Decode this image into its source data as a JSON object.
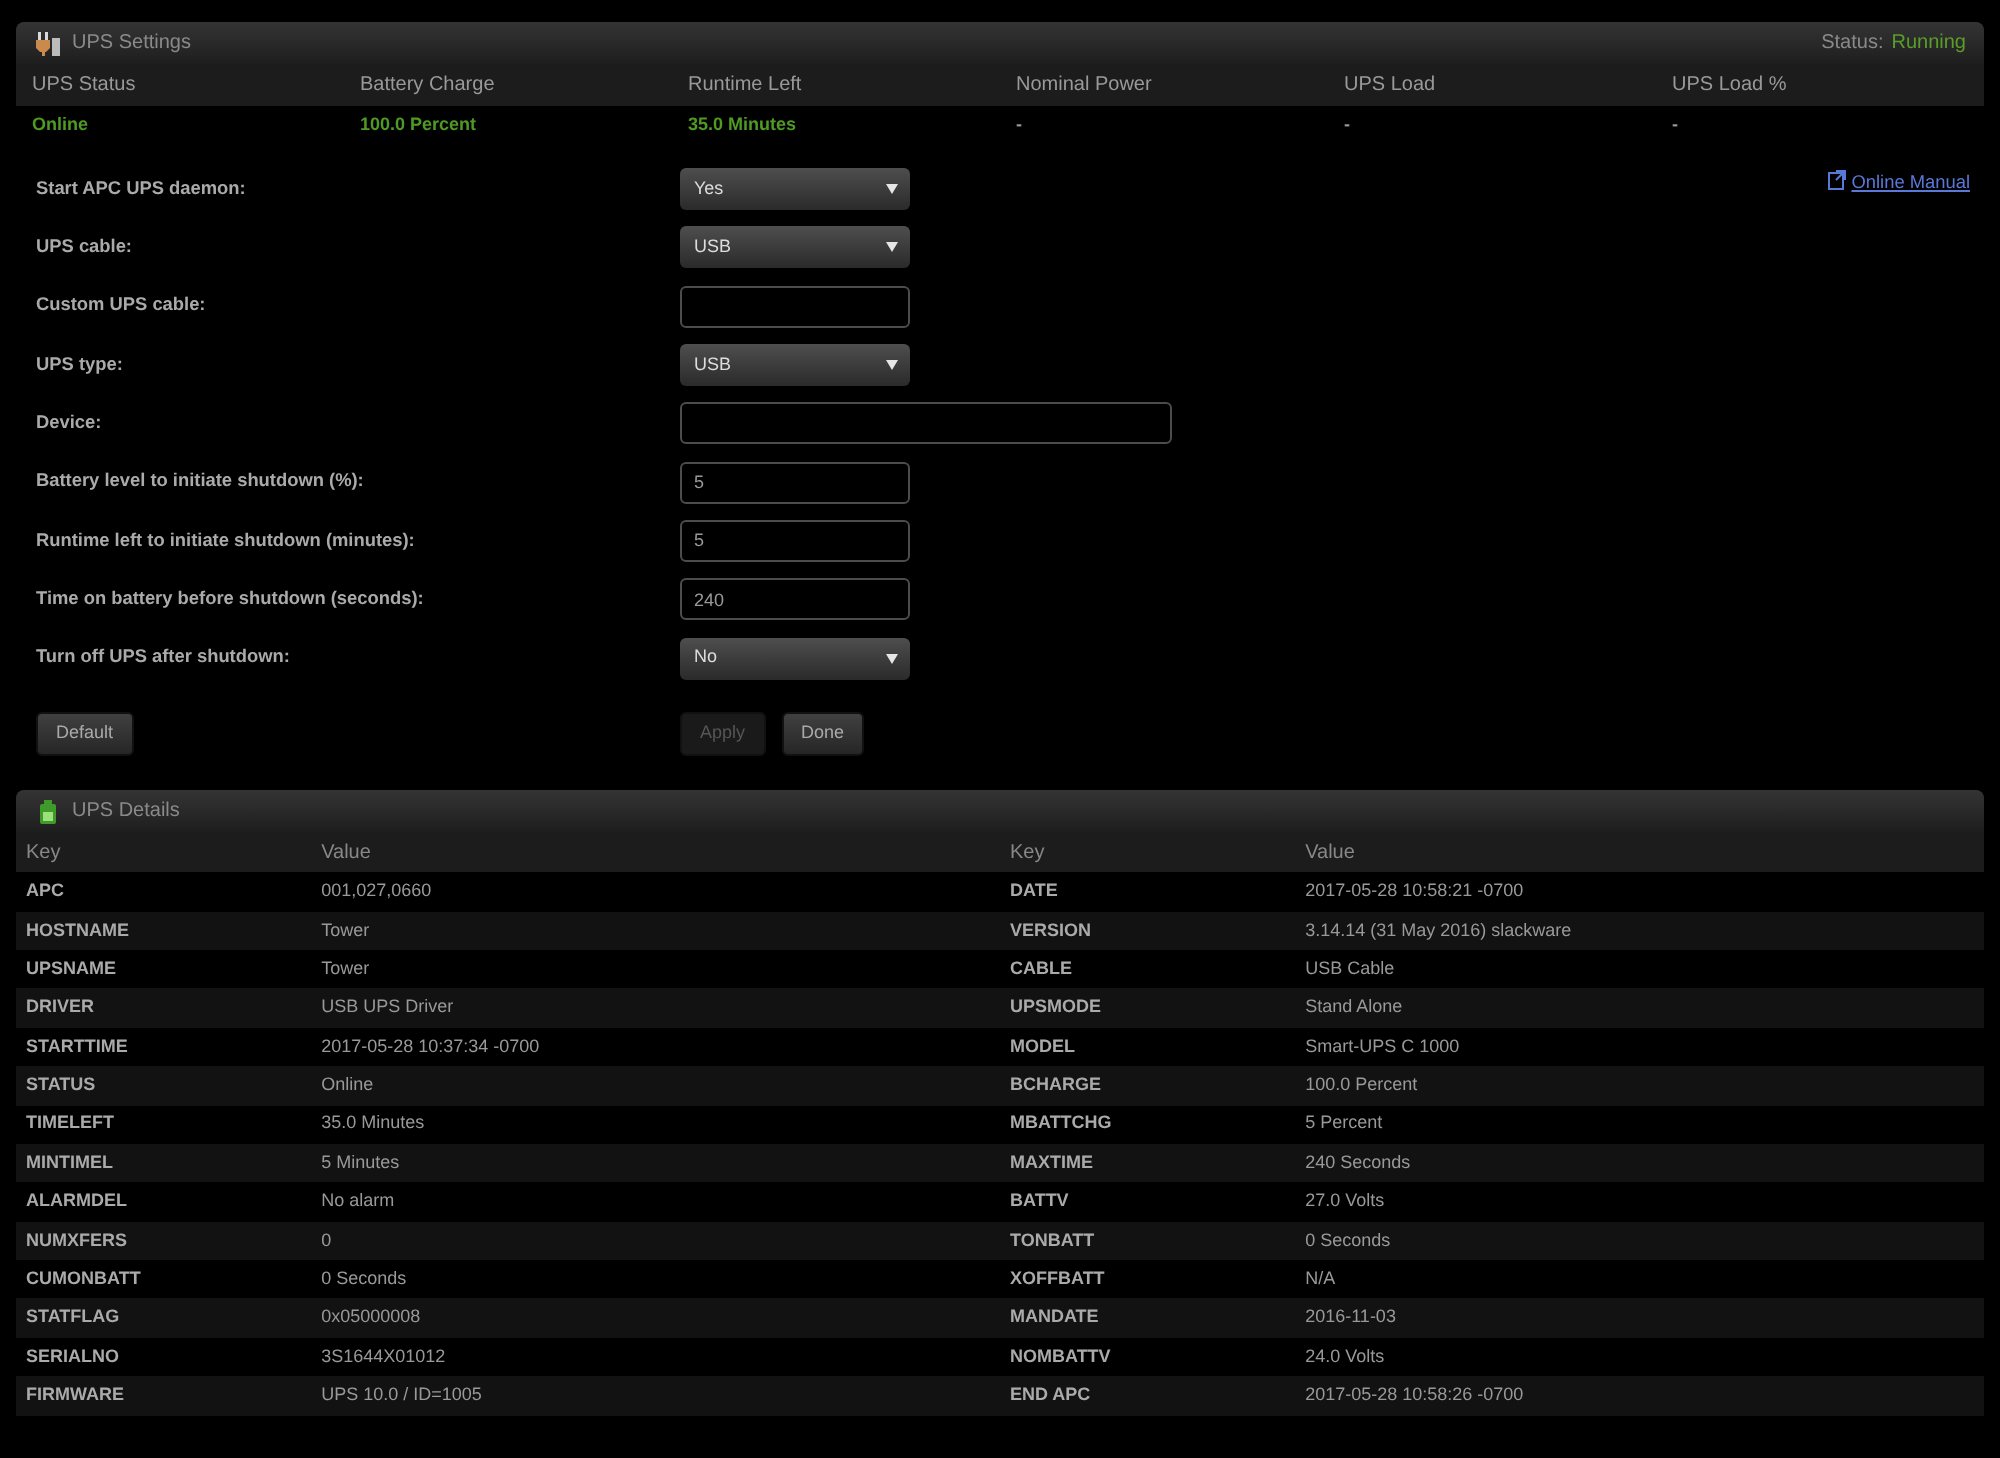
{
  "settings_panel": {
    "title": "UPS Settings",
    "status": {
      "label": "Status:",
      "value": "Running",
      "running": true
    },
    "summary": {
      "columns": [
        "UPS Status",
        "Battery Charge",
        "Runtime Left",
        "Nominal Power",
        "UPS Load",
        "UPS Load %"
      ],
      "values": [
        {
          "text": "Online",
          "color": "#4f9a22"
        },
        {
          "text": "100.0 Percent",
          "color": "#4f9a22"
        },
        {
          "text": "35.0 Minutes",
          "color": "#4f9a22"
        },
        {
          "text": "-",
          "color": "#999999"
        },
        {
          "text": "-",
          "color": "#999999"
        },
        {
          "text": "-",
          "color": "#999999"
        }
      ]
    },
    "manual_link": "Online Manual",
    "fields": [
      {
        "label": "Start APC UPS daemon:",
        "kind": "select",
        "value": "Yes"
      },
      {
        "label": "UPS cable:",
        "kind": "select",
        "value": "USB"
      },
      {
        "label": "Custom UPS cable:",
        "kind": "text"
      },
      {
        "label": "UPS type:",
        "kind": "select",
        "value": "USB"
      },
      {
        "label": "Device:",
        "kind": "long_text"
      },
      {
        "label": "Battery level to initiate shutdown (%):",
        "kind": "text",
        "value": "5"
      },
      {
        "label": "Runtime left to initiate shutdown (minutes):",
        "kind": "text",
        "value": "5"
      },
      {
        "label": "Time on battery before shutdown (seconds):",
        "kind": "text",
        "value": "240"
      },
      {
        "label": "Turn off UPS after shutdown:",
        "kind": "select",
        "value": "No"
      }
    ],
    "buttons": [
      {
        "label": "Default",
        "kind": "reset",
        "disabled": false
      },
      {
        "label": "Apply",
        "kind": "submit",
        "disabled": true
      },
      {
        "label": "Done",
        "kind": "submit",
        "disabled": false
      }
    ]
  },
  "details_panel": {
    "title": "UPS Details",
    "columns": [
      "Key",
      "Value",
      "Key",
      "Value"
    ],
    "rows": [
      [
        "APC",
        "001,027,0660",
        "DATE",
        "2017-05-28 10:58:21 -0700"
      ],
      [
        "HOSTNAME",
        "Tower",
        "VERSION",
        "3.14.14 (31 May 2016) slackware"
      ],
      [
        "UPSNAME",
        "Tower",
        "CABLE",
        "USB Cable"
      ],
      [
        "DRIVER",
        "USB UPS Driver",
        "UPSMODE",
        "Stand Alone"
      ],
      [
        "STARTTIME",
        "2017-05-28 10:37:34 -0700",
        "MODEL",
        "Smart-UPS C 1000"
      ],
      [
        "STATUS",
        "Online",
        "BCHARGE",
        "100.0 Percent"
      ],
      [
        "TIMELEFT",
        "35.0 Minutes",
        "MBATTCHG",
        "5 Percent"
      ],
      [
        "MINTIMEL",
        "5 Minutes",
        "MAXTIME",
        "240 Seconds"
      ],
      [
        "ALARMDEL",
        "No alarm",
        "BATTV",
        "27.0 Volts"
      ],
      [
        "NUMXFERS",
        "0",
        "TONBATT",
        "0 Seconds"
      ],
      [
        "CUMONBATT",
        "0 Seconds",
        "XOFFBATT",
        "N/A"
      ],
      [
        "STATFLAG",
        "0x05000008",
        "MANDATE",
        "2016-11-03"
      ],
      [
        "SERIALNO",
        "3S1644X01012",
        "NOMBATTV",
        "24.0 Volts"
      ],
      [
        "FIRMWARE",
        "UPS 10.0 / ID=1005",
        "END APC",
        "2017-05-28 10:58:26 -0700"
      ]
    ]
  }
}
